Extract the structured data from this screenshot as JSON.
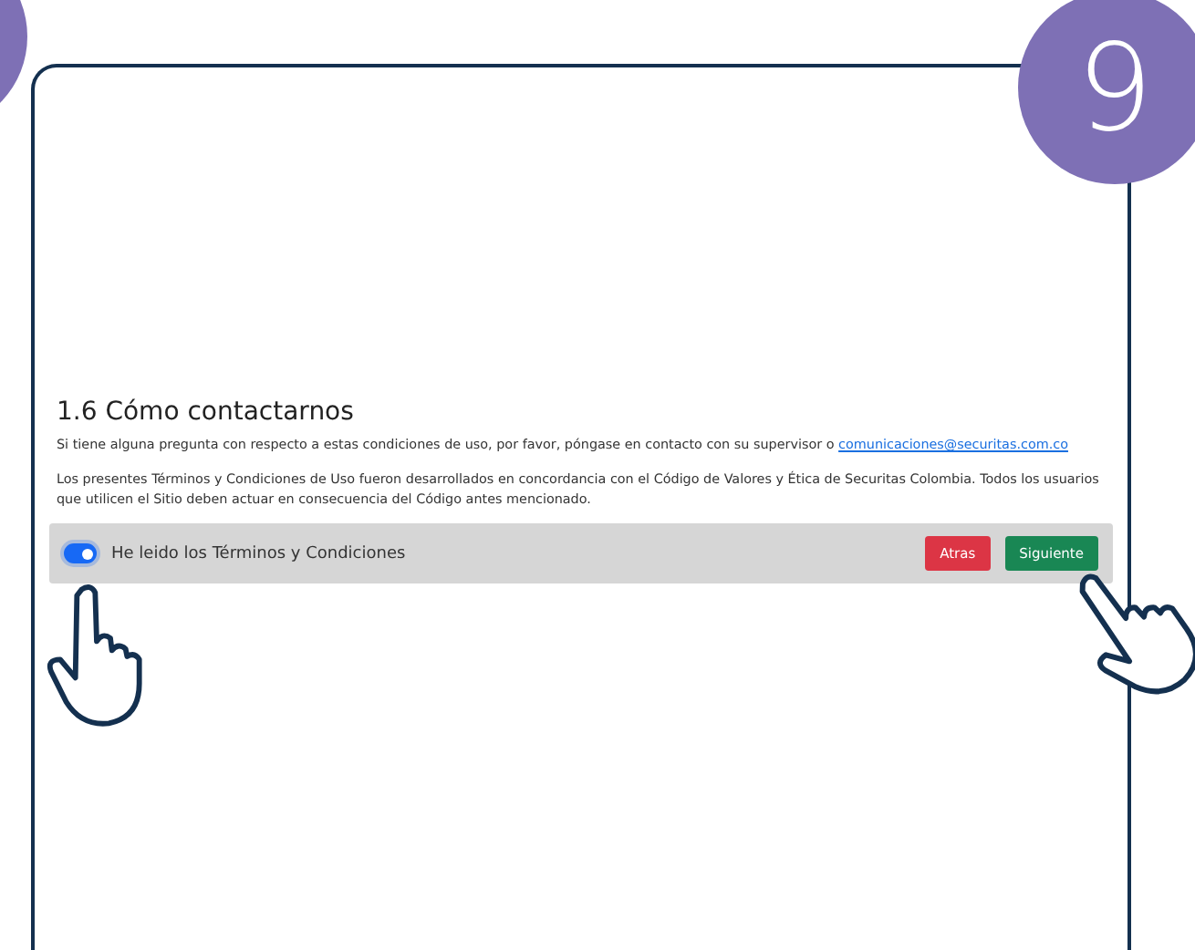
{
  "step_badge": {
    "number": "9"
  },
  "section": {
    "heading": "1.6 Cómo contactarnos",
    "contact_text": "Si tiene alguna pregunta con respecto a estas condiciones de uso, por favor, póngase en contacto con su supervisor o",
    "contact_link": "comunicaciones@securitas.com.co",
    "paragraph": "Los presentes Términos y Condiciones de Uso fueron desarrollados en concordancia con el Código de Valores y Ética de Securitas Colombia. Todos los usuarios que utilicen el Sitio deben actuar en consecuencia del Código antes mencionado."
  },
  "consent_bar": {
    "toggle": {
      "label": "He leido los Términos y Condiciones",
      "on": true
    },
    "buttons": [
      {
        "label": "Atras",
        "kind": "back"
      },
      {
        "label": "Siguiente",
        "kind": "next"
      }
    ]
  }
}
